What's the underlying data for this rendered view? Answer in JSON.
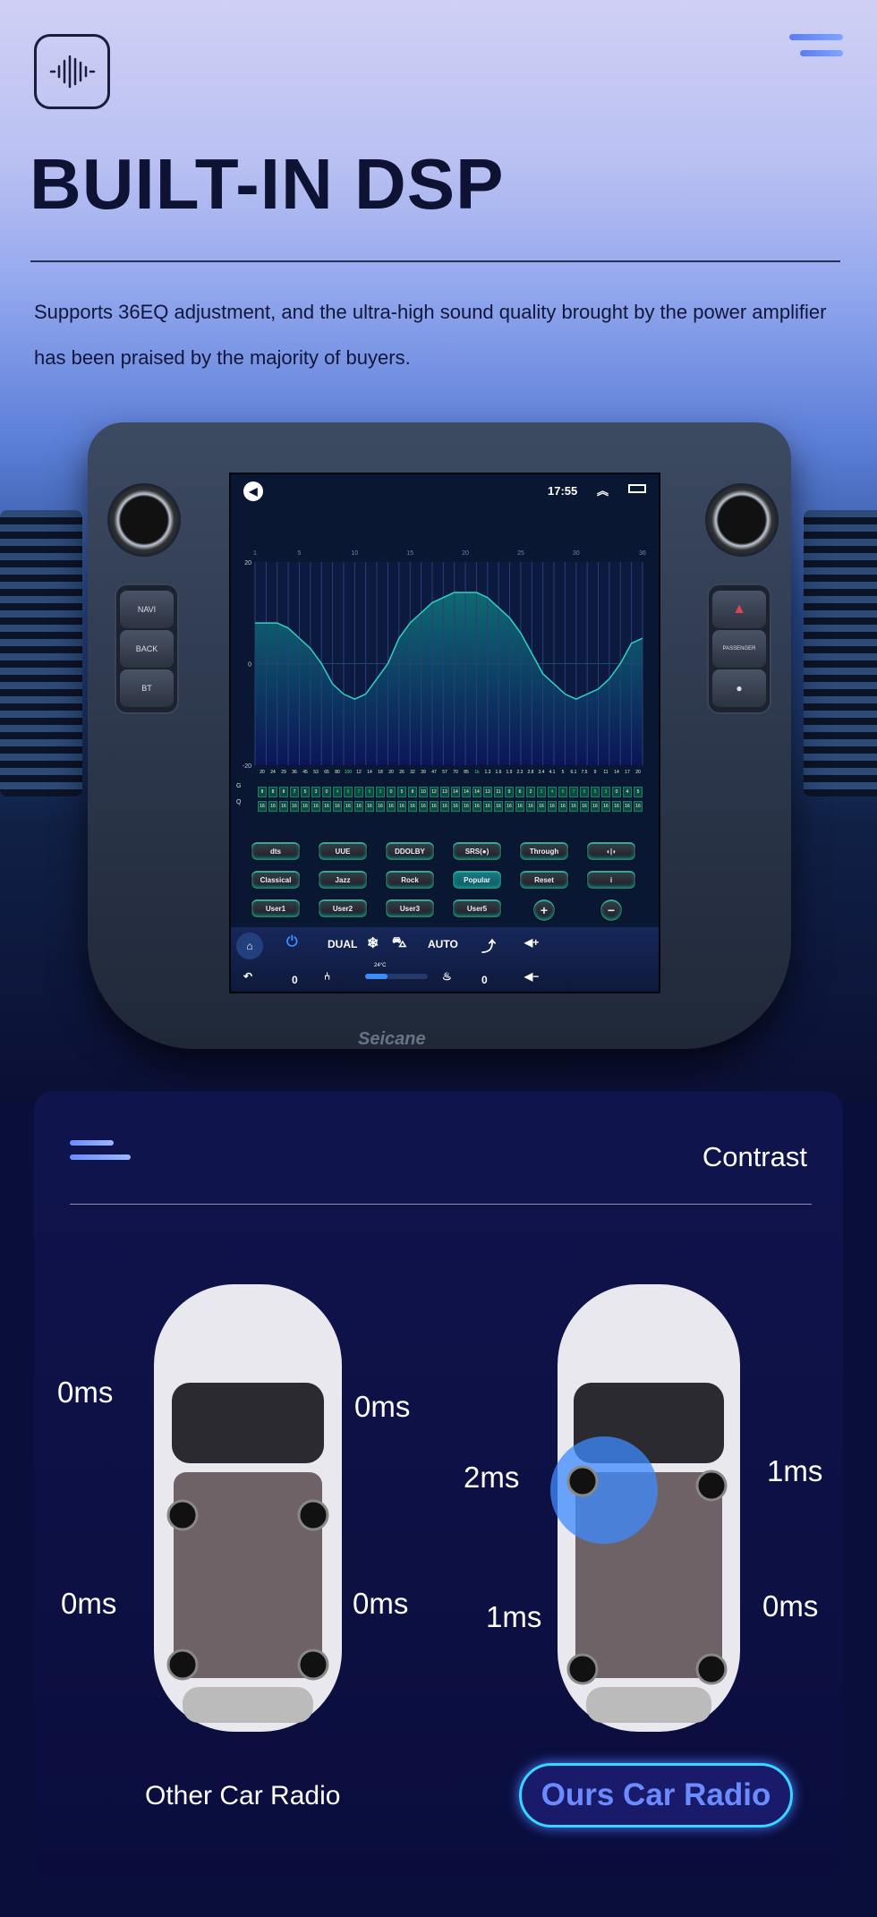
{
  "header": {
    "title": "BUILT-IN DSP",
    "description": "Supports 36EQ adjustment, and the ultra-high sound quality brought by the power amplifier has been praised by the majority of buyers.",
    "logo_icon": "sound-wave-icon",
    "menu_icon": "hamburger-icon"
  },
  "head_unit": {
    "left_keys": [
      "NAVI",
      "BACK",
      "BT"
    ],
    "right_keys": [
      "hazard",
      "PASSENGER",
      "power"
    ],
    "brand": "Seicane",
    "screen": {
      "time": "17:55",
      "eq": {
        "band_ticks": [
          "1",
          "5",
          "10",
          "15",
          "20",
          "25",
          "30",
          "36"
        ],
        "y_ticks": [
          "20",
          "0",
          "-20"
        ],
        "ylim": [
          -20,
          20
        ],
        "row_labels": {
          "g": "G",
          "q": "Q"
        },
        "freqs": [
          "20",
          "24",
          "29",
          "36",
          "45",
          "53",
          "65",
          "80",
          "100",
          "12",
          "14",
          "18",
          "20",
          "26",
          "32",
          "39",
          "47",
          "57",
          "70",
          "85",
          "1k",
          "1.3",
          "1.6",
          "1.9",
          "2.3",
          "2.8",
          "3.4",
          "4.1",
          "5",
          "6.1",
          "7.5",
          "9",
          "11",
          "14",
          "17",
          "20"
        ],
        "highlight_freqs": [
          "100",
          "1k"
        ],
        "gain": [
          8,
          8,
          8,
          7,
          5,
          3,
          0,
          -4,
          -6,
          -7,
          -6,
          -3,
          0,
          5,
          8,
          10,
          12,
          13,
          14,
          14,
          14,
          13,
          11,
          9,
          6,
          2,
          -2,
          -4,
          -6,
          -7,
          -6,
          -5,
          -3,
          0,
          4,
          5
        ],
        "q": [
          16,
          16,
          16,
          16,
          16,
          16,
          16,
          16,
          16,
          16,
          16,
          16,
          16,
          16,
          16,
          16,
          16,
          16,
          16,
          16,
          16,
          16,
          16,
          16,
          16,
          16,
          16,
          16,
          16,
          16,
          16,
          16,
          16,
          16,
          16,
          16
        ],
        "curve_color": "#2fd3c0",
        "negative_color": "#3de07a"
      },
      "buttons": [
        [
          "dts",
          "UUE",
          "DDOLBY",
          "SRS(●)",
          "Through",
          "◖|◗"
        ],
        [
          "Classical",
          "Jazz",
          "Rock",
          "Popular",
          "Reset",
          "i"
        ],
        [
          "User1",
          "User2",
          "User3",
          "User5",
          "+",
          "−"
        ]
      ],
      "active_preset": "Popular",
      "climate": {
        "dual": "DUAL",
        "auto": "AUTO",
        "temp": "24°C",
        "left_value": "0",
        "right_value": "0",
        "fan_level": 0.35
      }
    }
  },
  "contrast": {
    "title": "Contrast",
    "other": {
      "label": "Other Car Radio",
      "delays": [
        "0ms",
        "0ms",
        "0ms",
        "0ms"
      ]
    },
    "ours": {
      "label": "Ours Car Radio",
      "delays": [
        "2ms",
        "1ms",
        "1ms",
        "0ms"
      ]
    }
  }
}
